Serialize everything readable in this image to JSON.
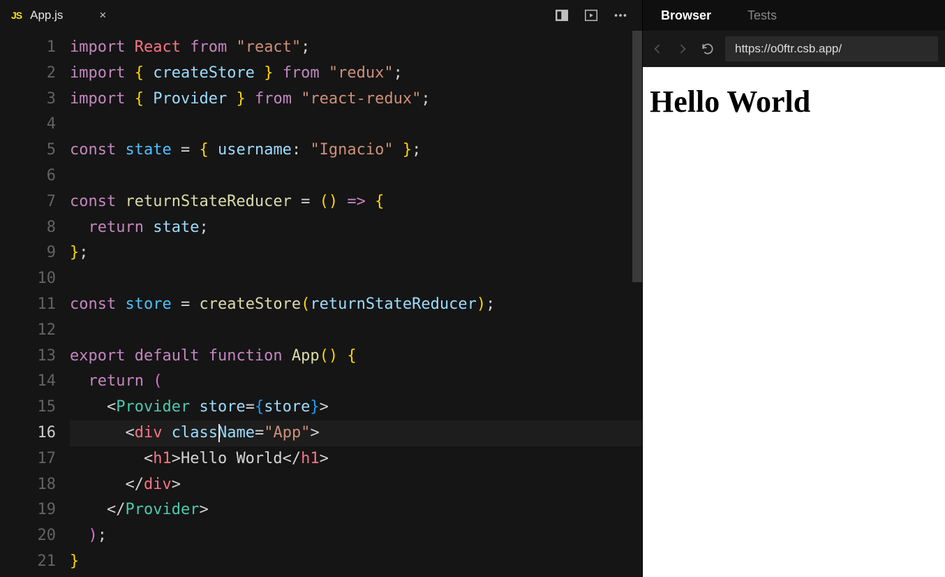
{
  "editor": {
    "tab": {
      "badge": "JS",
      "filename": "App.js"
    },
    "activeLine": 16,
    "cursorCol": 14,
    "lines": [
      {
        "n": 1,
        "tokens": [
          [
            "kw",
            "import"
          ],
          [
            "pun",
            " "
          ],
          [
            "red",
            "React"
          ],
          [
            "pun",
            " "
          ],
          [
            "kw",
            "from"
          ],
          [
            "pun",
            " "
          ],
          [
            "str",
            "\"react\""
          ],
          [
            "pun",
            ";"
          ]
        ]
      },
      {
        "n": 2,
        "tokens": [
          [
            "kw",
            "import"
          ],
          [
            "pun",
            " "
          ],
          [
            "brace",
            "{"
          ],
          [
            "pun",
            " "
          ],
          [
            "id",
            "createStore"
          ],
          [
            "pun",
            " "
          ],
          [
            "brace",
            "}"
          ],
          [
            "pun",
            " "
          ],
          [
            "kw",
            "from"
          ],
          [
            "pun",
            " "
          ],
          [
            "str",
            "\"redux\""
          ],
          [
            "pun",
            ";"
          ]
        ]
      },
      {
        "n": 3,
        "tokens": [
          [
            "kw",
            "import"
          ],
          [
            "pun",
            " "
          ],
          [
            "brace",
            "{"
          ],
          [
            "pun",
            " "
          ],
          [
            "id",
            "Provider"
          ],
          [
            "pun",
            " "
          ],
          [
            "brace",
            "}"
          ],
          [
            "pun",
            " "
          ],
          [
            "kw",
            "from"
          ],
          [
            "pun",
            " "
          ],
          [
            "str",
            "\"react-redux\""
          ],
          [
            "pun",
            ";"
          ]
        ]
      },
      {
        "n": 4,
        "tokens": []
      },
      {
        "n": 5,
        "tokens": [
          [
            "kw",
            "const"
          ],
          [
            "pun",
            " "
          ],
          [
            "var",
            "state"
          ],
          [
            "pun",
            " "
          ],
          [
            "pun",
            "="
          ],
          [
            "pun",
            " "
          ],
          [
            "brace",
            "{"
          ],
          [
            "pun",
            " "
          ],
          [
            "id",
            "username"
          ],
          [
            "pun",
            ":"
          ],
          [
            "pun",
            " "
          ],
          [
            "str",
            "\"Ignacio\""
          ],
          [
            "pun",
            " "
          ],
          [
            "brace",
            "}"
          ],
          [
            "pun",
            ";"
          ]
        ]
      },
      {
        "n": 6,
        "tokens": []
      },
      {
        "n": 7,
        "tokens": [
          [
            "kw",
            "const"
          ],
          [
            "pun",
            " "
          ],
          [
            "fn",
            "returnStateReducer"
          ],
          [
            "pun",
            " "
          ],
          [
            "pun",
            "="
          ],
          [
            "pun",
            " "
          ],
          [
            "brace",
            "("
          ],
          [
            "brace",
            ")"
          ],
          [
            "pun",
            " "
          ],
          [
            "kw",
            "=>"
          ],
          [
            "pun",
            " "
          ],
          [
            "brace",
            "{"
          ]
        ]
      },
      {
        "n": 8,
        "tokens": [
          [
            "pun",
            "  "
          ],
          [
            "kw",
            "return"
          ],
          [
            "pun",
            " "
          ],
          [
            "id",
            "state"
          ],
          [
            "pun",
            ";"
          ]
        ]
      },
      {
        "n": 9,
        "tokens": [
          [
            "brace",
            "}"
          ],
          [
            "pun",
            ";"
          ]
        ]
      },
      {
        "n": 10,
        "tokens": []
      },
      {
        "n": 11,
        "tokens": [
          [
            "kw",
            "const"
          ],
          [
            "pun",
            " "
          ],
          [
            "var",
            "store"
          ],
          [
            "pun",
            " "
          ],
          [
            "pun",
            "="
          ],
          [
            "pun",
            " "
          ],
          [
            "fn",
            "createStore"
          ],
          [
            "brace",
            "("
          ],
          [
            "id",
            "returnStateReducer"
          ],
          [
            "brace",
            ")"
          ],
          [
            "pun",
            ";"
          ]
        ]
      },
      {
        "n": 12,
        "tokens": []
      },
      {
        "n": 13,
        "tokens": [
          [
            "kw",
            "export"
          ],
          [
            "pun",
            " "
          ],
          [
            "kw",
            "default"
          ],
          [
            "pun",
            " "
          ],
          [
            "kw",
            "function"
          ],
          [
            "pun",
            " "
          ],
          [
            "fn",
            "App"
          ],
          [
            "brace",
            "("
          ],
          [
            "brace",
            ")"
          ],
          [
            "pun",
            " "
          ],
          [
            "brace",
            "{"
          ]
        ]
      },
      {
        "n": 14,
        "tokens": [
          [
            "pun",
            "  "
          ],
          [
            "kw",
            "return"
          ],
          [
            "pun",
            " "
          ],
          [
            "brace2",
            "("
          ]
        ]
      },
      {
        "n": 15,
        "tokens": [
          [
            "pun",
            "    "
          ],
          [
            "pun",
            "<"
          ],
          [
            "comp",
            "Provider"
          ],
          [
            "pun",
            " "
          ],
          [
            "attr",
            "store"
          ],
          [
            "pun",
            "="
          ],
          [
            "brace3",
            "{"
          ],
          [
            "id",
            "store"
          ],
          [
            "brace3",
            "}"
          ],
          [
            "pun",
            ">"
          ]
        ]
      },
      {
        "n": 16,
        "tokens": [
          [
            "pun",
            "      "
          ],
          [
            "pun",
            "<"
          ],
          [
            "tag",
            "div"
          ],
          [
            "pun",
            " "
          ],
          [
            "attr",
            "className"
          ],
          [
            "pun",
            "="
          ],
          [
            "str",
            "\"App\""
          ],
          [
            "pun",
            ">"
          ]
        ]
      },
      {
        "n": 17,
        "tokens": [
          [
            "pun",
            "        "
          ],
          [
            "pun",
            "<"
          ],
          [
            "tag",
            "h1"
          ],
          [
            "pun",
            ">"
          ],
          [
            "pun",
            "Hello World"
          ],
          [
            "pun",
            "</"
          ],
          [
            "tag",
            "h1"
          ],
          [
            "pun",
            ">"
          ]
        ]
      },
      {
        "n": 18,
        "tokens": [
          [
            "pun",
            "      "
          ],
          [
            "pun",
            "</"
          ],
          [
            "tag",
            "div"
          ],
          [
            "pun",
            ">"
          ]
        ]
      },
      {
        "n": 19,
        "tokens": [
          [
            "pun",
            "    "
          ],
          [
            "pun",
            "</"
          ],
          [
            "comp",
            "Provider"
          ],
          [
            "pun",
            ">"
          ]
        ]
      },
      {
        "n": 20,
        "tokens": [
          [
            "pun",
            "  "
          ],
          [
            "brace2",
            ")"
          ],
          [
            "pun",
            ";"
          ]
        ]
      },
      {
        "n": 21,
        "tokens": [
          [
            "brace",
            "}"
          ]
        ]
      }
    ]
  },
  "side": {
    "tabs": [
      {
        "label": "Browser",
        "active": true
      },
      {
        "label": "Tests",
        "active": false
      }
    ],
    "url": "https://o0ftr.csb.app/",
    "preview_heading": "Hello World"
  }
}
